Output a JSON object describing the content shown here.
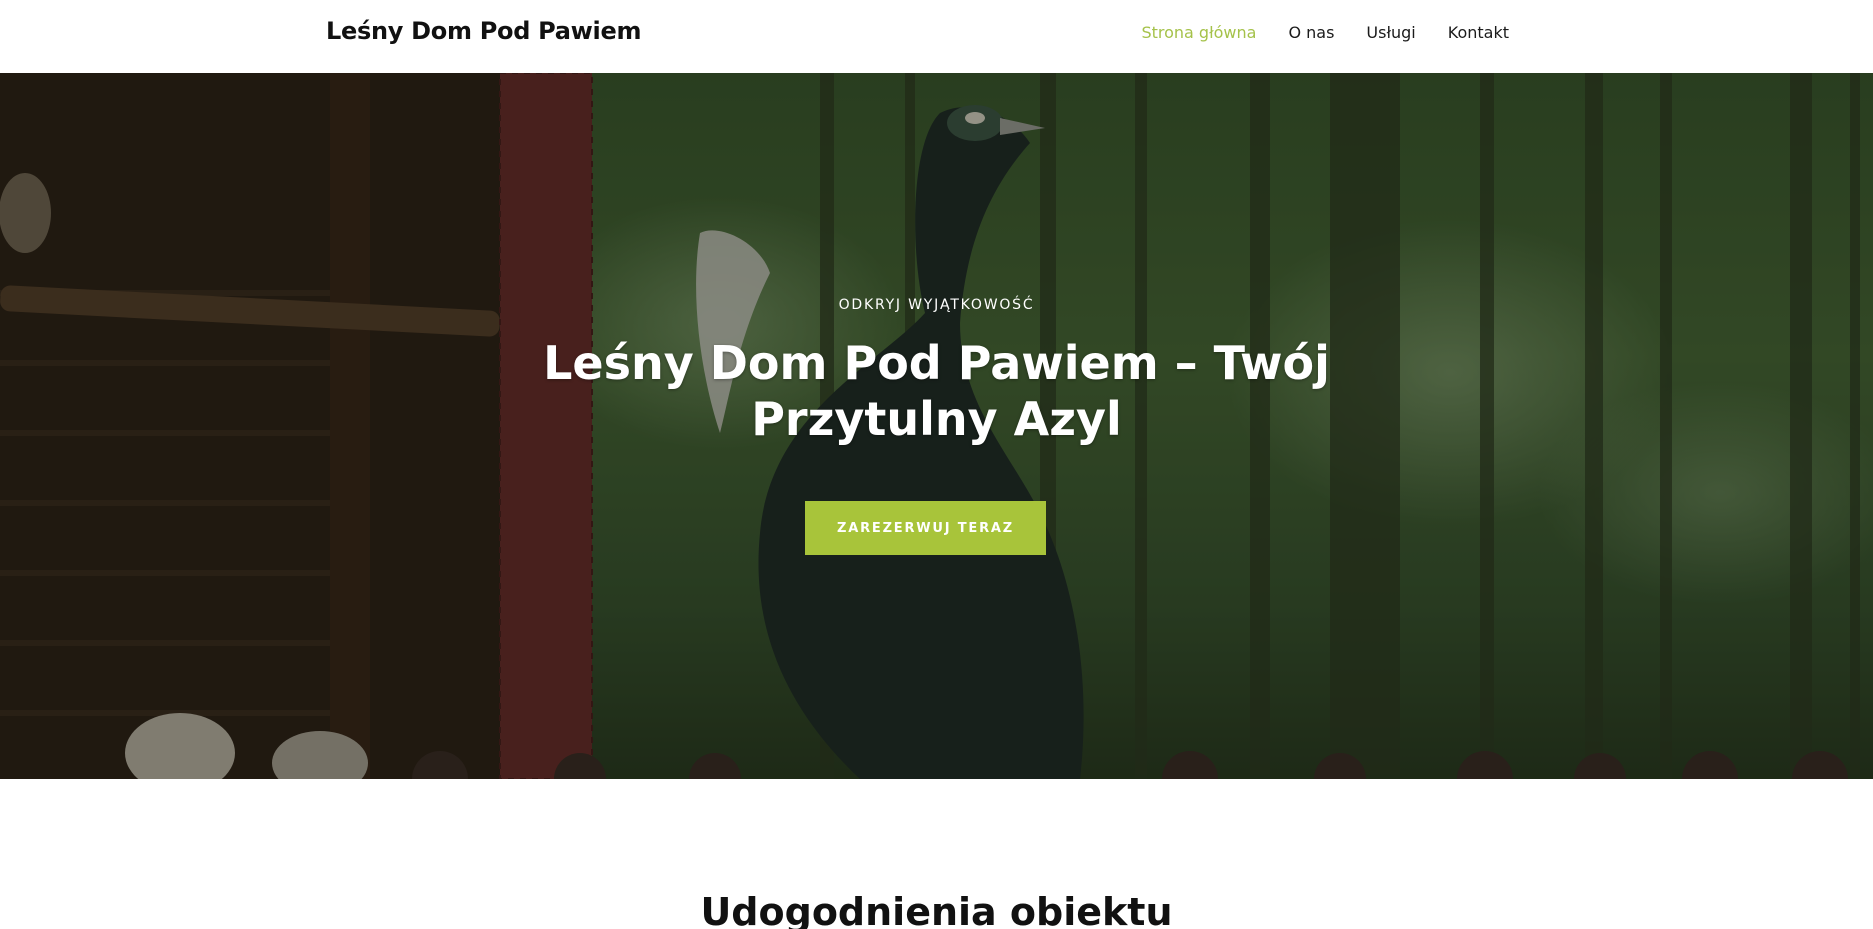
{
  "header": {
    "site_title": "Leśny Dom Pod Pawiem",
    "nav": [
      {
        "label": "Strona główna",
        "active": true
      },
      {
        "label": "O nas",
        "active": false
      },
      {
        "label": "Usługi",
        "active": false
      },
      {
        "label": "Kontakt",
        "active": false
      }
    ],
    "active_color": "#a5c24a"
  },
  "hero": {
    "eyebrow": "ODKRYJ WYJĄTKOWOŚĆ",
    "headline": "Leśny Dom Pod Pawiem – Twój Przytulny Azyl",
    "cta_label": "ZAREZERWUJ TERAZ",
    "cta_color": "#a8c43a",
    "background_image": "peacock-in-forest-enclosure"
  },
  "section": {
    "title": "Udogodnienia obiektu"
  }
}
